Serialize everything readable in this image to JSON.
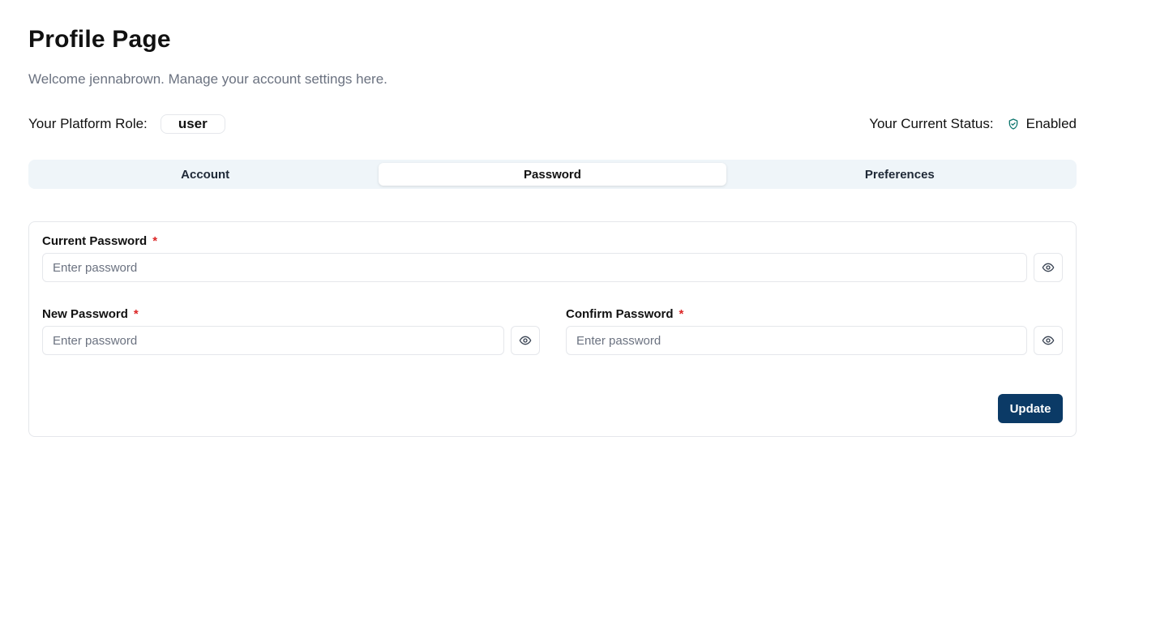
{
  "page": {
    "title": "Profile Page",
    "welcome": "Welcome jennabrown. Manage your account settings here."
  },
  "role": {
    "label": "Your Platform Role:",
    "value": "user"
  },
  "status": {
    "label": "Your Current Status:",
    "value": "Enabled",
    "icon": "shield-check-icon",
    "icon_color": "#0f766e"
  },
  "tabs": [
    {
      "label": "Account",
      "active": false
    },
    {
      "label": "Password",
      "active": true
    },
    {
      "label": "Preferences",
      "active": false
    }
  ],
  "form": {
    "required_marker": "*",
    "current_password": {
      "label": "Current Password",
      "placeholder": "Enter password",
      "value": ""
    },
    "new_password": {
      "label": "New Password",
      "placeholder": "Enter password",
      "value": ""
    },
    "confirm_password": {
      "label": "Confirm Password",
      "placeholder": "Enter password",
      "value": ""
    },
    "eye_icon": "eye-icon",
    "submit_label": "Update"
  },
  "colors": {
    "primary_button": "#0b3a66",
    "required": "#dc2626",
    "tab_bar_bg": "#eff5f9"
  }
}
